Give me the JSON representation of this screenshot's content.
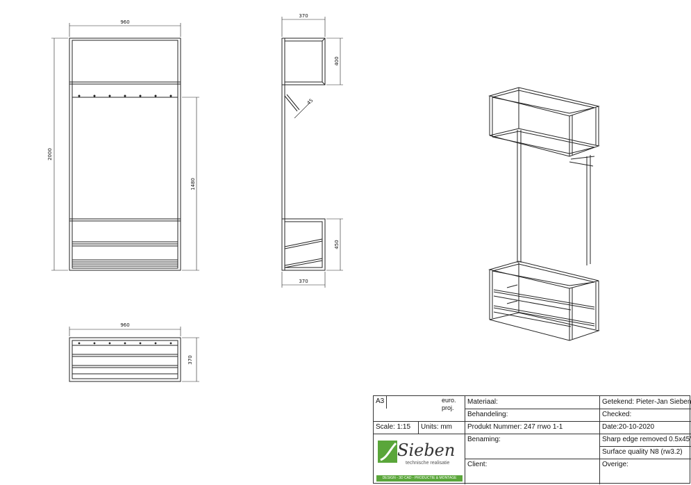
{
  "dimensions": {
    "front_width": "960",
    "front_height": "2000",
    "front_inner_height": "1480",
    "side_top_depth": "370",
    "side_top_height": "400",
    "side_angle": "45",
    "side_bottom_height": "450",
    "side_bottom_depth": "370",
    "top_view_width": "960",
    "top_view_depth": "370"
  },
  "title_block": {
    "sheet_size": "A3",
    "projection_line1": "euro.",
    "projection_line2": "proj.",
    "scale": "Scale: 1:15",
    "units": "Units: mm",
    "materiaal": "Materiaal:",
    "behandeling": "Behandeling:",
    "produkt_nummer": "Produkt Nummer: 247 rrwo 1-1",
    "benaming": "Benaming:",
    "client": "Client:",
    "getekend": "Getekend: Pieter-Jan Sieben",
    "checked": "Checked:",
    "date": "Date:20-10-2020",
    "sharp_edge": "Sharp edge removed 0.5x45°",
    "surface_quality": "Surface quality N8 (rw3.2)",
    "overige": "Overige:",
    "logo_name": "Sieben",
    "logo_tagline": "technische realisatie",
    "logo_footer": "DESIGN - 3D CAD - PRODUCTIE & MONTAGE"
  },
  "colors": {
    "line": "#222222",
    "logo_green": "#5aa63a"
  }
}
